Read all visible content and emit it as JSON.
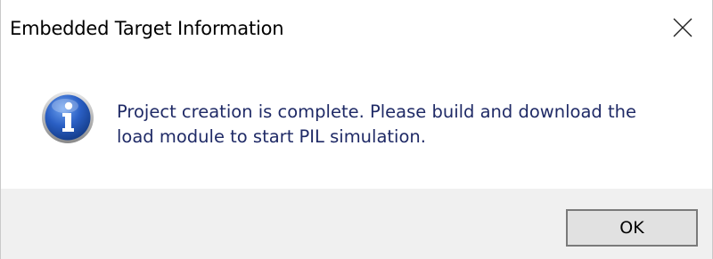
{
  "window": {
    "title": "Embedded Target Information",
    "close_icon": "close-icon"
  },
  "content": {
    "icon": "info-icon",
    "message_line1": "Project creation is complete. Please build and download the",
    "message_line2": "load module to start PIL simulation."
  },
  "footer": {
    "ok_label": "OK"
  },
  "colors": {
    "footer_bg": "#f0f0f0",
    "button_bg": "#e1e1e1",
    "button_border": "#7a7a7a",
    "message_text": "#1f2a66",
    "icon_blue": "#1f54b8"
  }
}
